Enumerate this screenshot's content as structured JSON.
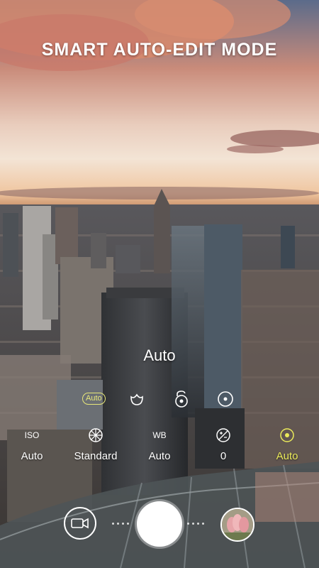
{
  "banner": {
    "title": "SMART AUTO-EDIT MODE"
  },
  "mode": {
    "current_label": "Auto"
  },
  "quick_controls": {
    "auto_badge": "Auto",
    "items": [
      {
        "name": "auto-scene-badge",
        "icon": "auto-badge"
      },
      {
        "name": "beauty-icon",
        "icon": "flower-icon"
      },
      {
        "name": "focus-lock-icon",
        "icon": "lock-icon"
      },
      {
        "name": "metering-icon",
        "icon": "target-icon"
      }
    ]
  },
  "settings": [
    {
      "key": "iso",
      "label": "ISO",
      "value": "Auto",
      "icon": null,
      "active": false
    },
    {
      "key": "filter",
      "label": "",
      "value": "Standard",
      "icon": "aperture-icon",
      "active": false
    },
    {
      "key": "wb",
      "label": "WB",
      "value": "Auto",
      "icon": null,
      "active": false
    },
    {
      "key": "ev",
      "label": "",
      "value": "0",
      "icon": "exposure-icon",
      "active": false
    },
    {
      "key": "focus",
      "label": "",
      "value": "Auto",
      "icon": "focus-icon",
      "active": true
    }
  ],
  "colors": {
    "accent": "#eaea5a",
    "badge": "#e8e87a"
  },
  "bottom_bar": {
    "video_icon": "video-camera-icon",
    "shutter": "shutter-button",
    "gallery": "gallery-thumbnail"
  }
}
